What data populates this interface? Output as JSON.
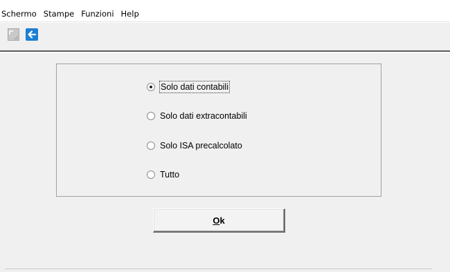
{
  "menubar": {
    "items": [
      {
        "label": "Schermo"
      },
      {
        "label": "Stampe"
      },
      {
        "label": "Funzioni"
      },
      {
        "label": "Help"
      }
    ]
  },
  "toolbar": {
    "buttons": [
      {
        "icon": "page-disabled-icon",
        "enabled": false
      },
      {
        "icon": "back-arrow-icon",
        "enabled": true,
        "color": "#1c7fd4"
      }
    ]
  },
  "options": {
    "selected_index": 0,
    "items": [
      {
        "label": "Solo dati contabili",
        "selected": true
      },
      {
        "label": "Solo dati extracontabili",
        "selected": false
      },
      {
        "label": "Solo ISA precalcolato",
        "selected": false
      },
      {
        "label": "Tutto",
        "selected": false
      }
    ]
  },
  "ok_button": {
    "accel": "O",
    "rest": "k"
  }
}
